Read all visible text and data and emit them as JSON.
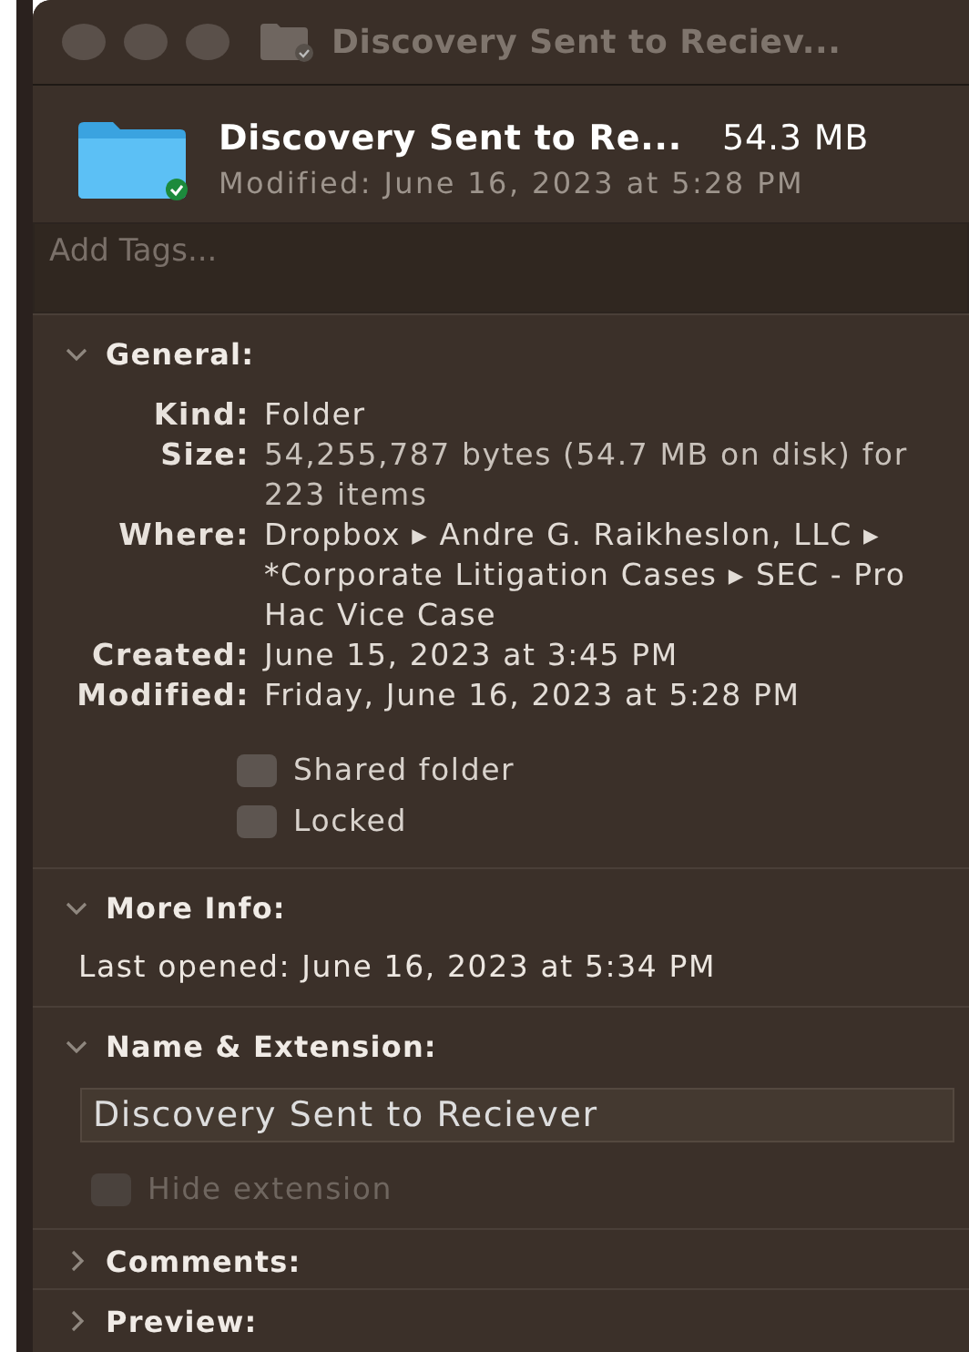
{
  "window": {
    "title": "Discovery Sent to Reciev..."
  },
  "header": {
    "name": "Discovery Sent to Re...",
    "size": "54.3 MB",
    "modified": "Modified: June 16, 2023 at 5:28 PM"
  },
  "tags": {
    "placeholder": "Add Tags..."
  },
  "general": {
    "title": "General:",
    "expanded": true,
    "rows": [
      {
        "label": "Kind:",
        "value": "Folder"
      },
      {
        "label": "Size:",
        "value": "54,255,787 bytes (54.7 MB on disk) for 223 items"
      },
      {
        "label": "Where:",
        "value": "Dropbox ▸ Andre G. Raikheslon, LLC ▸ *Corporate Litigation Cases ▸ SEC - Pro Hac Vice Case"
      },
      {
        "label": "Created:",
        "value": "June 15, 2023 at 3:45 PM"
      },
      {
        "label": "Modified:",
        "value": "Friday, June 16, 2023 at 5:28 PM"
      }
    ],
    "checkboxes": [
      {
        "label": "Shared folder",
        "checked": false
      },
      {
        "label": "Locked",
        "checked": false
      }
    ]
  },
  "more_info": {
    "title": "More Info:",
    "expanded": true,
    "last_opened": "Last opened: June 16, 2023 at 5:34 PM"
  },
  "name_extension": {
    "title": "Name & Extension:",
    "expanded": true,
    "value": "Discovery Sent to Reciever",
    "hide_extension": {
      "label": "Hide extension",
      "checked": false,
      "disabled": true
    }
  },
  "collapsed_sections": [
    {
      "title": "Comments:",
      "expanded": false
    },
    {
      "title": "Preview:",
      "expanded": false
    }
  ]
}
